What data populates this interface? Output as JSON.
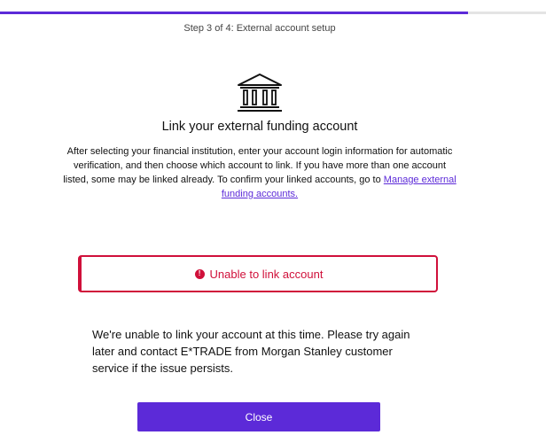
{
  "progress": {
    "fraction": 0.857,
    "color": "#5c2ad8"
  },
  "step_label": "Step 3 of 4: External account setup",
  "icons": {
    "bank": "bank-building-icon",
    "error": "exclamation-circle-icon"
  },
  "title": "Link your external funding account",
  "description": {
    "text": "After selecting your financial institution, enter your account login information for automatic verification, and then choose which account to link. If you have more than one account listed, some may be linked already. To confirm your linked accounts, go to ",
    "link_text": "Manage external funding accounts."
  },
  "error": {
    "heading": "Unable to link account",
    "message": "We're unable to link your account at this time. Please try again later and contact E*TRADE from Morgan Stanley customer service if the issue persists.",
    "color": "#d0103a"
  },
  "close_button_label": "Close"
}
